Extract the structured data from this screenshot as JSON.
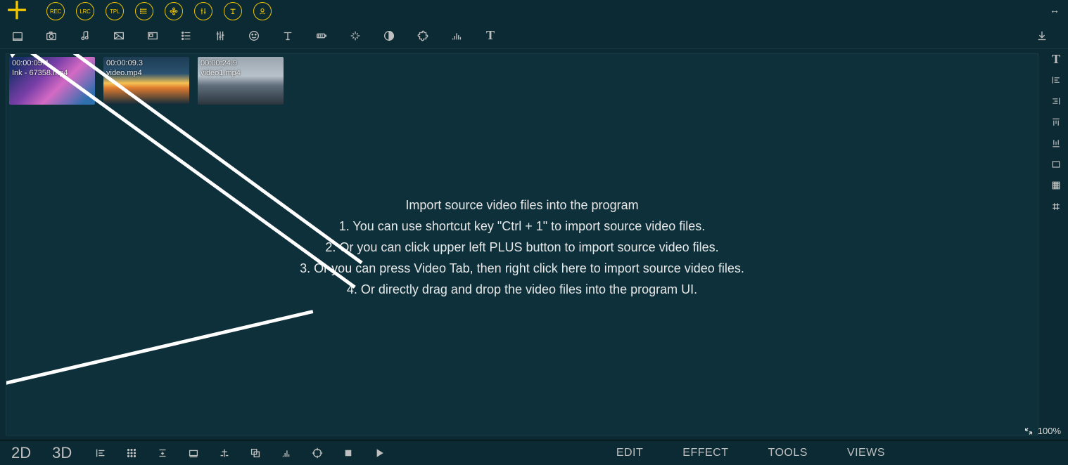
{
  "top_circles": {
    "rec": "REC",
    "lrc": "LRC",
    "tpl": "TPL"
  },
  "thumbs": [
    {
      "time": "00:00:05.4",
      "name": "Ink - 67358.mp4"
    },
    {
      "time": "00:00:09.3",
      "name": "video.mp4"
    },
    {
      "time": "00:00:24.9",
      "name": "video1.mp4"
    }
  ],
  "instructions": {
    "title": "Import source video files into the program",
    "line1": "1. You can use shortcut key \"Ctrl + 1\" to import source video files.",
    "line2": "2. Or you can click upper left PLUS button to import source video files.",
    "line3": "3. Or you can press Video Tab, then right click here to import source video files.",
    "line4": "4. Or directly drag and drop the video files into the program UI."
  },
  "bottom": {
    "mode2d": "2D",
    "mode3d": "3D",
    "edit": "EDIT",
    "effect": "EFFECT",
    "tools": "TOOLS",
    "views": "VIEWS"
  },
  "zoom": "100%"
}
